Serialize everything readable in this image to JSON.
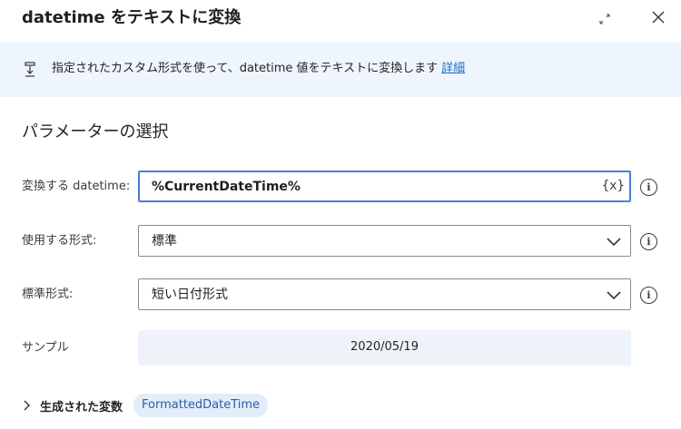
{
  "dialog": {
    "title": "datetime をテキストに変換",
    "expand_icon": "expand-diagonal-icon",
    "close_icon": "close-icon"
  },
  "info": {
    "icon": "info-action-icon",
    "text": "指定されたカスタム形式を使って、datetime 値をテキストに変換します",
    "link": "詳細"
  },
  "section": {
    "title": "パラメーターの選択"
  },
  "params": {
    "datetime_label": "変換する datetime:",
    "datetime_value": "%CurrentDateTime%",
    "variable_picker": "{x}",
    "format_label": "使用する形式:",
    "format_value": "標準",
    "standard_label": "標準形式:",
    "standard_value": "短い日付形式",
    "help_glyph": "i"
  },
  "sample": {
    "label": "サンプル",
    "value": "2020/05/19"
  },
  "generated": {
    "label": "生成された変数",
    "variable": "FormattedDateTime"
  },
  "colors": {
    "banner_bg": "#eff5fc",
    "link": "#1a6fd1",
    "focus_border": "#4a7fd4",
    "chip_bg": "#e3edf9",
    "chip_text": "#2a5ea8"
  }
}
